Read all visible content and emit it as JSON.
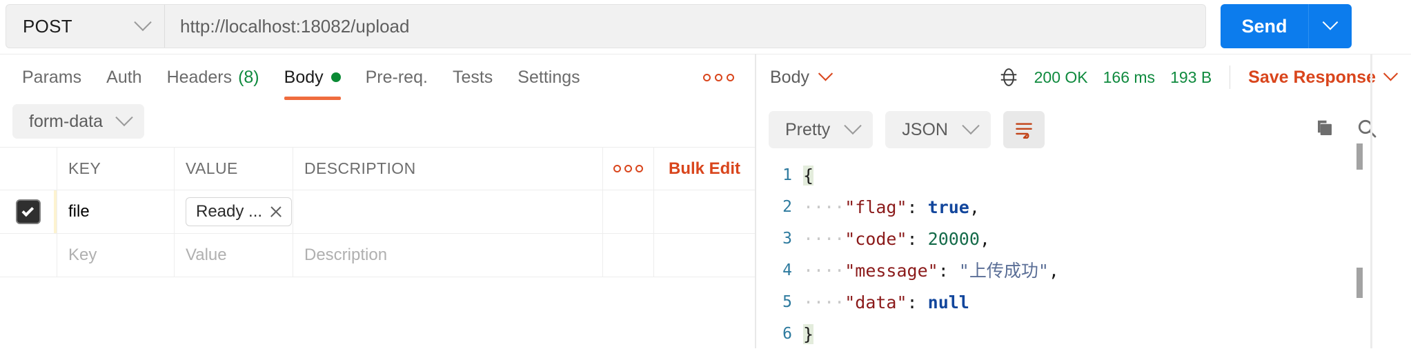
{
  "request": {
    "method": "POST",
    "url": "http://localhost:18082/upload",
    "send_label": "Send"
  },
  "tabs": [
    {
      "label": "Params",
      "active": false
    },
    {
      "label": "Auth",
      "active": false
    },
    {
      "label": "Headers",
      "count": "(8)",
      "active": false
    },
    {
      "label": "Body",
      "active": true,
      "dot": true
    },
    {
      "label": "Pre-req.",
      "active": false
    },
    {
      "label": "Tests",
      "active": false
    },
    {
      "label": "Settings",
      "active": false
    }
  ],
  "body": {
    "type_label": "form-data",
    "table": {
      "headers": {
        "key": "KEY",
        "value": "VALUE",
        "description": "DESCRIPTION",
        "bulk_edit": "Bulk Edit"
      },
      "rows": [
        {
          "checked": true,
          "key": "file",
          "value_chip": "Ready ...",
          "description": ""
        }
      ],
      "placeholders": {
        "key": "Key",
        "value": "Value",
        "description": "Description"
      }
    }
  },
  "response": {
    "section_label": "Body",
    "status": "200 OK",
    "time": "166 ms",
    "size": "193 B",
    "save_label": "Save Response",
    "format": "Pretty",
    "language": "JSON",
    "lines": [
      {
        "n": "1",
        "tokens": [
          {
            "t": "brace",
            "v": "{"
          }
        ]
      },
      {
        "n": "2",
        "tokens": [
          {
            "t": "ind",
            "v": "····"
          },
          {
            "t": "key",
            "v": "\"flag\""
          },
          {
            "t": "punct",
            "v": ": "
          },
          {
            "t": "bool",
            "v": "true"
          },
          {
            "t": "punct",
            "v": ","
          }
        ]
      },
      {
        "n": "3",
        "tokens": [
          {
            "t": "ind",
            "v": "····"
          },
          {
            "t": "key",
            "v": "\"code\""
          },
          {
            "t": "punct",
            "v": ": "
          },
          {
            "t": "num",
            "v": "20000"
          },
          {
            "t": "punct",
            "v": ","
          }
        ]
      },
      {
        "n": "4",
        "tokens": [
          {
            "t": "ind",
            "v": "····"
          },
          {
            "t": "key",
            "v": "\"message\""
          },
          {
            "t": "punct",
            "v": ": "
          },
          {
            "t": "str",
            "v": "\"上传成功\""
          },
          {
            "t": "punct",
            "v": ","
          }
        ]
      },
      {
        "n": "5",
        "tokens": [
          {
            "t": "ind",
            "v": "····"
          },
          {
            "t": "key",
            "v": "\"data\""
          },
          {
            "t": "punct",
            "v": ": "
          },
          {
            "t": "bool",
            "v": "null"
          }
        ]
      },
      {
        "n": "6",
        "tokens": [
          {
            "t": "brace",
            "v": "}"
          }
        ]
      }
    ]
  },
  "colors": {
    "accent_orange": "#d9451c",
    "send_blue": "#0c7ced",
    "status_green": "#0f8a3e",
    "tab_underline": "#ef6c3e"
  }
}
